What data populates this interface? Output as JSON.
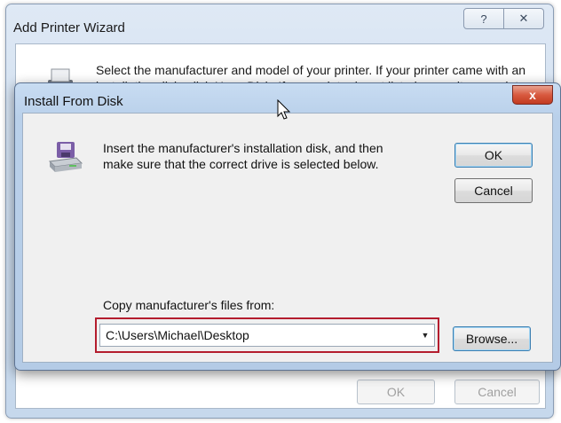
{
  "wizard": {
    "title": "Add Printer Wizard",
    "help_icon": "question-icon",
    "close_icon": "close-icon",
    "help_symbol": "?",
    "close_symbol": "✕",
    "description": "Select the manufacturer and model of your printer. If your printer came with an installation disk, click Have Disk. If your printer is not listed, consult your printer documentation for a compatible printer.",
    "ok_label": "OK",
    "cancel_label": "Cancel"
  },
  "dialog": {
    "title": "Install From Disk",
    "close_symbol": "x",
    "message": "Insert the manufacturer's installation disk, and then make sure that the correct drive is selected below.",
    "ok_label": "OK",
    "cancel_label": "Cancel",
    "copy_label": "Copy manufacturer's files from:",
    "path_value": "C:\\Users\\Michael\\Desktop",
    "dropdown_symbol": "▼",
    "browse_label": "Browse...",
    "icon": "disk-drive-icon"
  },
  "colors": {
    "highlight_border": "#b41d2e",
    "close_button": "#c23b20",
    "title_bar": "#b9d0ea"
  }
}
